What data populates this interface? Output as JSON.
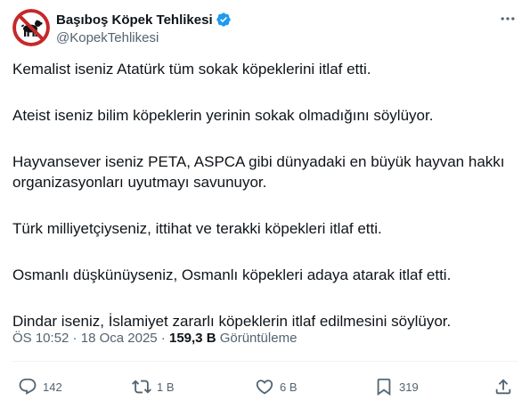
{
  "author": {
    "display_name": "Başıboş Köpek Tehlikesi",
    "handle": "@KopekTehlikesi",
    "verified_icon": "verified-badge-icon",
    "avatar_icon": "no-dogs-sign-icon"
  },
  "tweet": {
    "paragraphs": [
      "Kemalist iseniz Atatürk tüm sokak köpeklerini itlaf etti.",
      "Ateist iseniz bilim köpeklerin yerinin sokak olmadığını söylüyor.",
      "Hayvansever iseniz PETA, ASPCA gibi dünyadaki en büyük hayvan hakkı",
      "organizasyonları uyutmayı savunuyor.",
      "Türk milliyetçiyseniz, ittihat ve terakki  köpekleri itlaf etti.",
      "Osmanlı düşkünüyseniz, Osmanlı köpekleri adaya atarak itlaf etti.",
      "Dindar iseniz, İslamiyet zararlı köpeklerin itlaf edilmesini söylüyor."
    ]
  },
  "meta": {
    "time": "ÖS 10:52",
    "separator": " · ",
    "date": "18 Oca 2025",
    "views_count": "159,3 B",
    "views_label": "Görüntüleme"
  },
  "actions": {
    "reply_count": "142",
    "retweet_count": "1 B",
    "like_count": "6 B",
    "bookmark_count": "319"
  },
  "colors": {
    "text": "#0f1419",
    "secondary": "#536471",
    "verified": "#1d9bf0",
    "divider": "#eff3f4"
  }
}
